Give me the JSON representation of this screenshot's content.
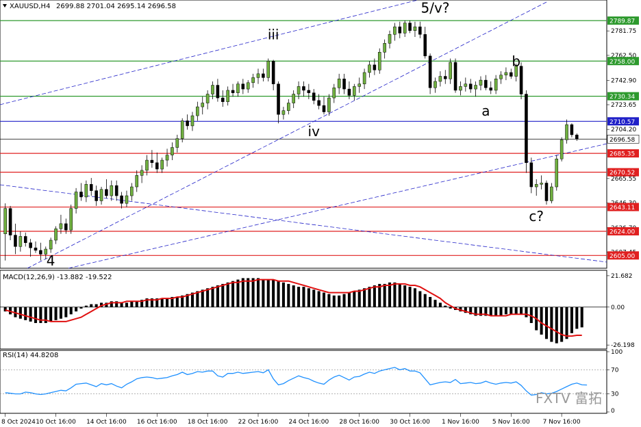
{
  "header": {
    "symbol": "XAUUSD,H4",
    "ohlc": "2699.88 2701.04 2695.14 2696.58"
  },
  "chart_data": {
    "type": "candlestick",
    "symbol": "XAUUSD",
    "timeframe": "H4",
    "price_axis": {
      "range": [
        2596,
        2805
      ],
      "ticks": [
        "2781.75",
        "2762.50",
        "2742.90",
        "2723.65",
        "2704.20",
        "2665.55",
        "2646.30",
        "2626.70",
        "2607.45"
      ]
    },
    "current_price": 2696.58,
    "current_price_label": "2696.58",
    "level_lines": [
      {
        "value": 2789.87,
        "label": "2789.87",
        "color": "#2e9a2e"
      },
      {
        "value": 2758.0,
        "label": "2758.00",
        "color": "#2e9a2e"
      },
      {
        "value": 2730.34,
        "label": "2730.34",
        "color": "#2e9a2e"
      },
      {
        "value": 2710.57,
        "label": "2710.57",
        "color": "#2020c8"
      },
      {
        "value": 2685.35,
        "label": "2685.35",
        "color": "#e02020"
      },
      {
        "value": 2670.52,
        "label": "2670.52",
        "color": "#e02020"
      },
      {
        "value": 2643.11,
        "label": "2643.11",
        "color": "#e02020"
      },
      {
        "value": 2624.0,
        "label": "2624.00",
        "color": "#e02020"
      },
      {
        "value": 2605.0,
        "label": "2605.00",
        "color": "#e02020"
      }
    ],
    "wave_labels": [
      {
        "text": "iii",
        "bar": 53,
        "price": 2775
      },
      {
        "text": "5/v?",
        "bar": 85,
        "price": 2796
      },
      {
        "text": "b",
        "bar": 101,
        "price": 2754
      },
      {
        "text": "a",
        "bar": 95,
        "price": 2715
      },
      {
        "text": "iv",
        "bar": 61,
        "price": 2699
      },
      {
        "text": "c?",
        "bar": 105,
        "price": 2632
      },
      {
        "text": "4",
        "bar": 9,
        "price": 2597
      }
    ],
    "candles": [
      [
        2622,
        2646,
        2601,
        2642
      ],
      [
        2642,
        2644,
        2617,
        2621
      ],
      [
        2621,
        2630,
        2606,
        2612
      ],
      [
        2612,
        2624,
        2608,
        2620
      ],
      [
        2620,
        2623,
        2612,
        2615
      ],
      [
        2615,
        2618,
        2604,
        2611
      ],
      [
        2611,
        2616,
        2607,
        2609
      ],
      [
        2609,
        2615,
        2601,
        2606
      ],
      [
        2606,
        2612,
        2602,
        2610
      ],
      [
        2610,
        2619,
        2607,
        2617
      ],
      [
        2617,
        2628,
        2614,
        2626
      ],
      [
        2626,
        2637,
        2622,
        2630
      ],
      [
        2630,
        2634,
        2622,
        2625
      ],
      [
        2625,
        2645,
        2622,
        2642
      ],
      [
        2642,
        2658,
        2638,
        2655
      ],
      [
        2655,
        2662,
        2648,
        2651
      ],
      [
        2651,
        2664,
        2647,
        2661
      ],
      [
        2661,
        2666,
        2652,
        2656
      ],
      [
        2656,
        2660,
        2644,
        2648
      ],
      [
        2648,
        2659,
        2645,
        2657
      ],
      [
        2657,
        2665,
        2650,
        2652
      ],
      [
        2652,
        2664,
        2648,
        2660
      ],
      [
        2660,
        2664,
        2648,
        2652
      ],
      [
        2652,
        2655,
        2642,
        2646
      ],
      [
        2646,
        2656,
        2643,
        2652
      ],
      [
        2652,
        2662,
        2648,
        2659
      ],
      [
        2659,
        2672,
        2655,
        2668
      ],
      [
        2668,
        2676,
        2662,
        2672
      ],
      [
        2672,
        2684,
        2668,
        2680
      ],
      [
        2680,
        2688,
        2674,
        2678
      ],
      [
        2678,
        2686,
        2670,
        2673
      ],
      [
        2673,
        2682,
        2670,
        2680
      ],
      [
        2680,
        2689,
        2675,
        2684
      ],
      [
        2684,
        2694,
        2680,
        2690
      ],
      [
        2690,
        2700,
        2686,
        2697
      ],
      [
        2697,
        2713,
        2694,
        2711
      ],
      [
        2711,
        2716,
        2704,
        2707
      ],
      [
        2707,
        2718,
        2703,
        2715
      ],
      [
        2715,
        2726,
        2711,
        2722
      ],
      [
        2722,
        2730,
        2716,
        2725
      ],
      [
        2725,
        2735,
        2720,
        2732
      ],
      [
        2732,
        2742,
        2728,
        2739
      ],
      [
        2739,
        2744,
        2726,
        2729
      ],
      [
        2729,
        2735,
        2722,
        2726
      ],
      [
        2726,
        2738,
        2723,
        2735
      ],
      [
        2735,
        2740,
        2730,
        2733
      ],
      [
        2733,
        2742,
        2730,
        2740
      ],
      [
        2740,
        2744,
        2732,
        2736
      ],
      [
        2736,
        2743,
        2733,
        2741
      ],
      [
        2741,
        2748,
        2737,
        2745
      ],
      [
        2745,
        2752,
        2740,
        2748
      ],
      [
        2748,
        2752,
        2742,
        2745
      ],
      [
        2745,
        2760,
        2742,
        2758
      ],
      [
        2758,
        2759,
        2735,
        2740
      ],
      [
        2740,
        2742,
        2709,
        2716
      ],
      [
        2716,
        2722,
        2712,
        2719
      ],
      [
        2719,
        2728,
        2716,
        2725
      ],
      [
        2725,
        2735,
        2721,
        2732
      ],
      [
        2732,
        2742,
        2728,
        2738
      ],
      [
        2738,
        2742,
        2730,
        2735
      ],
      [
        2735,
        2740,
        2728,
        2733
      ],
      [
        2733,
        2736,
        2724,
        2727
      ],
      [
        2727,
        2732,
        2720,
        2723
      ],
      [
        2723,
        2730,
        2716,
        2718
      ],
      [
        2718,
        2732,
        2715,
        2729
      ],
      [
        2729,
        2740,
        2725,
        2737
      ],
      [
        2737,
        2748,
        2732,
        2744
      ],
      [
        2744,
        2748,
        2732,
        2736
      ],
      [
        2736,
        2742,
        2728,
        2731
      ],
      [
        2731,
        2740,
        2727,
        2738
      ],
      [
        2738,
        2745,
        2733,
        2740
      ],
      [
        2740,
        2752,
        2736,
        2749
      ],
      [
        2749,
        2758,
        2745,
        2755
      ],
      [
        2755,
        2760,
        2747,
        2751
      ],
      [
        2751,
        2768,
        2748,
        2765
      ],
      [
        2765,
        2775,
        2760,
        2772
      ],
      [
        2772,
        2782,
        2768,
        2779
      ],
      [
        2779,
        2788,
        2774,
        2785
      ],
      [
        2785,
        2789,
        2776,
        2780
      ],
      [
        2780,
        2790,
        2777,
        2788
      ],
      [
        2788,
        2790,
        2780,
        2782
      ],
      [
        2782,
        2789,
        2777,
        2785
      ],
      [
        2785,
        2789,
        2776,
        2779
      ],
      [
        2779,
        2785,
        2760,
        2762
      ],
      [
        2762,
        2764,
        2732,
        2737
      ],
      [
        2737,
        2745,
        2733,
        2742
      ],
      [
        2742,
        2750,
        2738,
        2746
      ],
      [
        2746,
        2751,
        2740,
        2744
      ],
      [
        2744,
        2760,
        2740,
        2757
      ],
      [
        2757,
        2760,
        2733,
        2735
      ],
      [
        2735,
        2742,
        2731,
        2738
      ],
      [
        2738,
        2745,
        2734,
        2740
      ],
      [
        2740,
        2744,
        2733,
        2736
      ],
      [
        2736,
        2742,
        2730,
        2739
      ],
      [
        2739,
        2746,
        2735,
        2743
      ],
      [
        2743,
        2747,
        2735,
        2737
      ],
      [
        2737,
        2742,
        2732,
        2735
      ],
      [
        2735,
        2747,
        2732,
        2744
      ],
      [
        2744,
        2750,
        2740,
        2747
      ],
      [
        2747,
        2753,
        2743,
        2749
      ],
      [
        2749,
        2752,
        2744,
        2746
      ],
      [
        2746,
        2756,
        2742,
        2754
      ],
      [
        2754,
        2757,
        2728,
        2732
      ],
      [
        2732,
        2735,
        2670,
        2678
      ],
      [
        2678,
        2682,
        2654,
        2659
      ],
      [
        2659,
        2665,
        2652,
        2661
      ],
      [
        2661,
        2668,
        2657,
        2662
      ],
      [
        2662,
        2664,
        2645,
        2648
      ],
      [
        2648,
        2662,
        2646,
        2659
      ],
      [
        2659,
        2684,
        2656,
        2681
      ],
      [
        2681,
        2698,
        2679,
        2696
      ],
      [
        2696,
        2712,
        2693,
        2708
      ],
      [
        2708,
        2709,
        2698,
        2700
      ],
      [
        2699.88,
        2701.04,
        2695.14,
        2696.58
      ]
    ],
    "macd": {
      "label": "MACD(12,26,9) -13.882 -19.522",
      "range": [
        -28,
        24
      ],
      "ticks": [
        "21.682",
        "0.00",
        "-26.198"
      ],
      "histogram": [
        -3,
        -5,
        -7,
        -8,
        -9,
        -10,
        -11,
        -11,
        -11,
        -10,
        -9,
        -8,
        -7,
        -5,
        -3,
        -1,
        1,
        2,
        2,
        3,
        3,
        4,
        4,
        3,
        3,
        4,
        4,
        5,
        6,
        6,
        6,
        6,
        6,
        7,
        7,
        8,
        9,
        10,
        11,
        12,
        13,
        14,
        15,
        16,
        17,
        18,
        19,
        20,
        20,
        20,
        20,
        19,
        19,
        19,
        18,
        17,
        16,
        15,
        14,
        14,
        13,
        12,
        11,
        10,
        9,
        8,
        8,
        9,
        10,
        11,
        12,
        13,
        14,
        15,
        16,
        16,
        17,
        17,
        16,
        15,
        14,
        13,
        11,
        9,
        7,
        5,
        3,
        1,
        -1,
        -2,
        -3,
        -4,
        -5,
        -6,
        -6,
        -6,
        -6,
        -6,
        -6,
        -5,
        -5,
        -5,
        -5,
        -7,
        -11,
        -16,
        -19,
        -22,
        -24,
        -25,
        -24,
        -22,
        -18,
        -15,
        -14
      ],
      "signal": [
        -2,
        -3,
        -4,
        -5,
        -6,
        -7,
        -8,
        -9,
        -9,
        -10,
        -10,
        -10,
        -10,
        -9,
        -8,
        -7,
        -5,
        -3,
        -1,
        1,
        2,
        3,
        3,
        3,
        4,
        4,
        4,
        4,
        5,
        5,
        5,
        6,
        6,
        6,
        7,
        7,
        8,
        9,
        10,
        11,
        12,
        13,
        14,
        15,
        16,
        17,
        17,
        18,
        18,
        18,
        19,
        19,
        19,
        19,
        18,
        18,
        18,
        17,
        16,
        15,
        14,
        13,
        12,
        11,
        10,
        10,
        10,
        10,
        10,
        11,
        11,
        12,
        13,
        14,
        14,
        15,
        15,
        16,
        16,
        16,
        15,
        15,
        14,
        12,
        10,
        8,
        6,
        3,
        1,
        -1,
        -2,
        -3,
        -4,
        -5,
        -5,
        -5,
        -6,
        -6,
        -6,
        -6,
        -5,
        -5,
        -5,
        -5,
        -6,
        -8,
        -11,
        -13,
        -15,
        -17,
        -19,
        -20,
        -20,
        -19.5,
        -19.5
      ]
    },
    "rsi": {
      "label": "RSI(14) 44.8208",
      "range": [
        0,
        100
      ],
      "ticks": [
        "100",
        "70",
        "30",
        "0"
      ],
      "levels": [
        70,
        30
      ],
      "values": [
        32,
        31,
        30,
        30,
        33,
        32,
        30,
        29,
        30,
        32,
        34,
        36,
        35,
        40,
        46,
        47,
        48,
        45,
        42,
        47,
        45,
        47,
        43,
        40,
        46,
        50,
        55,
        57,
        58,
        57,
        55,
        56,
        57,
        60,
        62,
        66,
        62,
        64,
        67,
        66,
        68,
        68,
        60,
        58,
        64,
        64,
        66,
        64,
        65,
        66,
        67,
        65,
        70,
        55,
        45,
        47,
        52,
        56,
        60,
        57,
        55,
        51,
        48,
        46,
        53,
        58,
        61,
        57,
        53,
        58,
        59,
        63,
        66,
        64,
        68,
        70,
        72,
        74,
        70,
        72,
        68,
        68,
        65,
        55,
        45,
        47,
        49,
        50,
        49,
        54,
        47,
        48,
        49,
        47,
        48,
        51,
        48,
        46,
        48,
        49,
        48,
        50,
        44,
        35,
        28,
        29,
        32,
        30,
        31,
        34,
        38,
        42,
        46,
        48,
        45,
        44.8
      ]
    },
    "time_labels": [
      "8 Oct 2024",
      "10 Oct 16:00",
      "14 Oct 16:00",
      "16 Oct 16:00",
      "18 Oct 16:00",
      "22 Oct 16:00",
      "24 Oct 16:00",
      "28 Oct 16:00",
      "30 Oct 16:00",
      "1 Nov 16:00",
      "5 Nov 16:00",
      "7 Nov 16:00"
    ],
    "time_label_bars": [
      0,
      10,
      20,
      30,
      40,
      50,
      60,
      70,
      80,
      90,
      100,
      110
    ]
  },
  "watermark": "FXTV 富拓",
  "colors": {
    "bull_body": "#70b040",
    "bear_body": "#000000",
    "macd_hist": "#000000",
    "macd_signal": "#e01010",
    "rsi_line": "#1e90ff",
    "channel": "#2020c8"
  }
}
